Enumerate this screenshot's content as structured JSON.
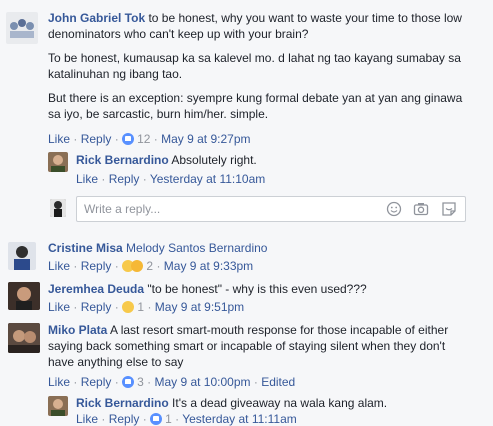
{
  "comments": [
    {
      "author": "John Gabriel Tok",
      "paragraphs": [
        [
          "to be honest, why you want to waste your time to those low",
          "denominators who can't keep up with your brain?"
        ],
        [
          "To be honest, kumausap ka sa kalevel mo. d lahat ng tao kayang sumabay sa",
          "katalinuhan ng ibang tao."
        ],
        [
          "But there is an exception: syempre kung formal debate yan at yan ang ginawa",
          "sa iyo, be sarcastic, burn him/her. simple."
        ]
      ],
      "like": "Like",
      "reply": "Reply",
      "reactions": "12",
      "time": "May 9 at 9:27pm"
    }
  ],
  "reply1": {
    "author": "Rick Bernardino",
    "text": "Absolutely right.",
    "like": "Like",
    "reply": "Reply",
    "time": "Yesterday at 11:10am"
  },
  "reply_box": {
    "placeholder": "Write a reply..."
  },
  "c2": {
    "author": "Cristine Misa",
    "tag": "Melody Santos Bernardino",
    "like": "Like",
    "reply": "Reply",
    "reactions": "2",
    "time": "May 9 at 9:33pm"
  },
  "c3": {
    "author": "Jeremhea Deuda",
    "text": "\"to be honest\" - why is this even used???",
    "like": "Like",
    "reply": "Reply",
    "reactions": "1",
    "time": "May 9 at 9:51pm"
  },
  "c4": {
    "author": "Miko Plata",
    "lines": [
      "A last resort smart-mouth response for those incapable of either",
      "saying back something smart or incapable of staying silent when they don't",
      "have anything else to say"
    ],
    "like": "Like",
    "reply": "Reply",
    "reactions": "3",
    "time": "May 9 at 10:00pm",
    "edited": "Edited"
  },
  "reply2": {
    "author": "Rick Bernardino",
    "text": "It's a dead giveaway na wala kang alam.",
    "like": "Like",
    "reply": "Reply",
    "reactions": "1",
    "time": "Yesterday at 11:11am"
  },
  "sep": "·"
}
